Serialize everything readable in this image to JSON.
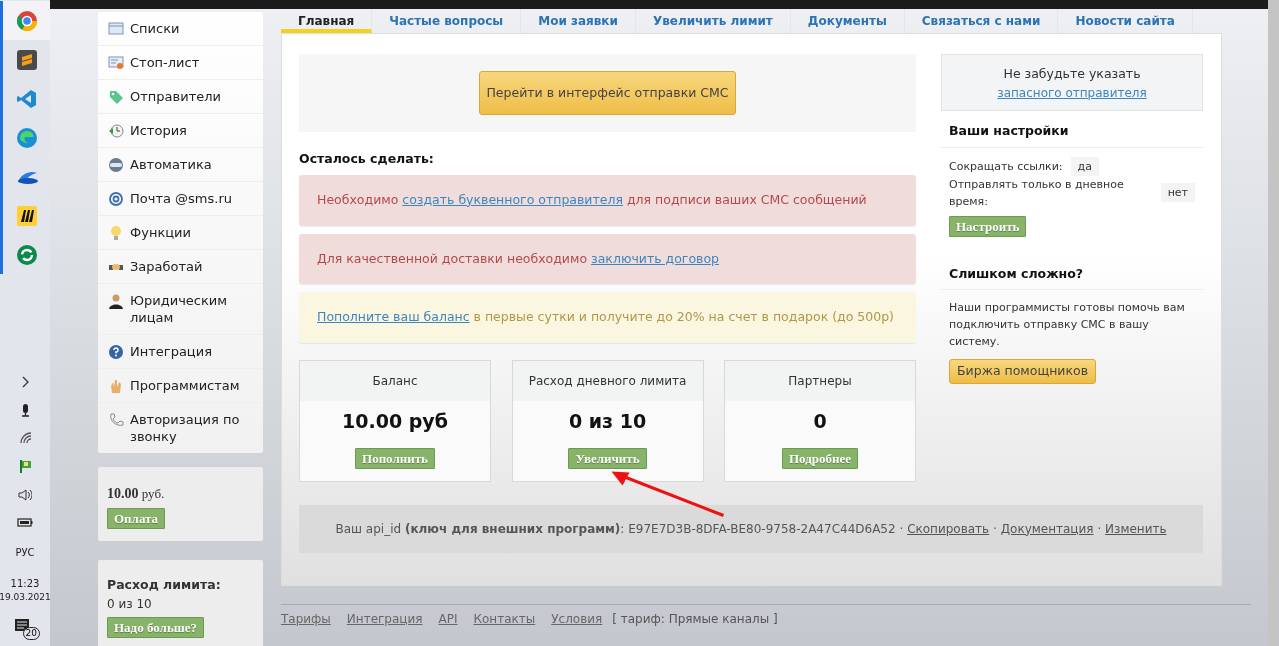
{
  "taskbar": {
    "language": "РУС",
    "time": "11:23",
    "date": "19.03.2021",
    "notifications": "20"
  },
  "sidebar": {
    "items": [
      {
        "label": "Списки"
      },
      {
        "label": "Стоп-лист"
      },
      {
        "label": "Отправители"
      },
      {
        "label": "История"
      },
      {
        "label": "Автоматика"
      },
      {
        "label": "Почта @sms.ru"
      },
      {
        "label": "Функции"
      },
      {
        "label": "Заработай"
      },
      {
        "label": "Юридическим лицам"
      },
      {
        "label": "Интеграция"
      },
      {
        "label": "Программистам"
      },
      {
        "label": "Авторизация по звонку"
      }
    ],
    "balance": {
      "amount": "10.00",
      "unit": "руб.",
      "button": "Оплата"
    },
    "limit": {
      "title": "Расход лимита:",
      "value": "0 из 10",
      "button": "Надо больше?"
    }
  },
  "tabs": [
    {
      "label": "Главная",
      "selected": true
    },
    {
      "label": "Частые вопросы",
      "selected": false
    },
    {
      "label": "Мои заявки",
      "selected": false
    },
    {
      "label": "Увеличить лимит",
      "selected": false
    },
    {
      "label": "Документы",
      "selected": false
    },
    {
      "label": "Связаться с нами",
      "selected": false
    },
    {
      "label": "Новости сайта",
      "selected": false
    }
  ],
  "send_button": "Перейти в интерфейс отправки СМС",
  "todo_title": "Осталось сделать:",
  "alerts": [
    {
      "kind": "danger",
      "before": "Необходимо ",
      "link": "создать буквенного отправителя",
      "after": " для подписи ваших СМС сообщений"
    },
    {
      "kind": "danger",
      "before": "Для качественной доставки необходимо ",
      "link": "заключить договор"
    },
    {
      "kind": "warning",
      "link": "Пополните ваш баланс",
      "after": " в первые сутки и получите до 20% на счет в подарок (до 500р)"
    }
  ],
  "stats": [
    {
      "title": "Баланс",
      "value": "10.00 руб",
      "button": "Пополнить"
    },
    {
      "title": "Расход дневного лимита",
      "value": "0 из 10",
      "button": "Увеличить"
    },
    {
      "title": "Партнеры",
      "value": "0",
      "button": "Подробнее"
    }
  ],
  "api": {
    "text": "Ваш api_id **(ключ для внешних программ)**: E97E7D3B-8DFA-BE80-9758-2A47C44D6A52",
    "links": [
      {
        "separator": "·",
        "label": "Скопировать"
      },
      {
        "separator": "·",
        "label": "Документация"
      },
      {
        "separator": "·",
        "label": "Изменить"
      }
    ]
  },
  "reminder": {
    "text": "Не забудьте указать",
    "link": "запасного отправителя"
  },
  "settings": {
    "title": "Ваши настройки",
    "rows": [
      {
        "label": "Сокращать ссылки:",
        "value": "да"
      },
      {
        "label": "Отправлять только в дневное время:",
        "value": "нет"
      }
    ],
    "button": "Настроить"
  },
  "help": {
    "title": "Слишком сложно?",
    "text": "Наши программисты готовы помочь вам подключить отправку СМС в вашу систему.",
    "button": "Биржа помощников"
  },
  "footer": {
    "links": [
      "Тарифы",
      "Интеграция",
      "API",
      "Контакты",
      "Условия"
    ],
    "tariff": "[ тариф: Прямые каналы ]"
  }
}
